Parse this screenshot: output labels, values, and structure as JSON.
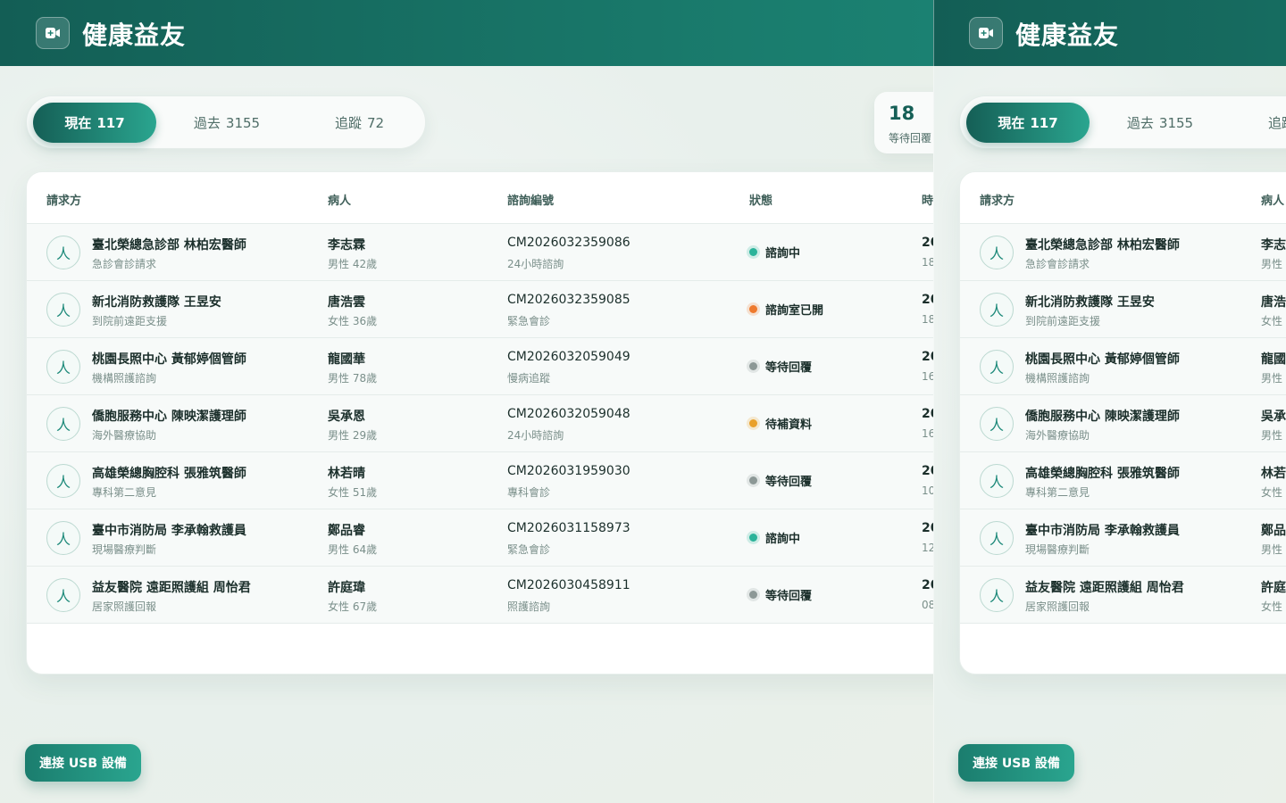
{
  "app": {
    "title": "健康益友",
    "logo_icon": "video-camera-plus-icon"
  },
  "tabs": [
    {
      "label": "現在",
      "count": "117",
      "active": true
    },
    {
      "label": "過去",
      "count": "3155",
      "active": false
    },
    {
      "label": "追蹤",
      "count": "72",
      "active": false
    }
  ],
  "stat": {
    "value": "18",
    "label": "等待回覆"
  },
  "table": {
    "headers": {
      "requester": "請求方",
      "patient": "病人",
      "consult_id": "諮詢編號",
      "status": "狀態",
      "time": "時"
    },
    "rows": [
      {
        "requester": "臺北榮總急診部 林柏宏醫師",
        "request_type": "急診會診請求",
        "patient": "李志霖",
        "patient_info": "男性 42歲",
        "consult_id": "CM2026032359086",
        "consult_type": "24小時諮詢",
        "status": "諮詢中",
        "status_color": "#2bb39a",
        "time_main": "20",
        "time_sub": "18:"
      },
      {
        "requester": "新北消防救護隊 王昱安",
        "request_type": "到院前遠距支援",
        "patient": "唐浩雲",
        "patient_info": "女性 36歲",
        "consult_id": "CM2026032359085",
        "consult_type": "緊急會診",
        "status": "諮詢室已開",
        "status_color": "#ee7a2e",
        "time_main": "20",
        "time_sub": "18:"
      },
      {
        "requester": "桃園長照中心 黃郁婷個管師",
        "request_type": "機構照護諮詢",
        "patient": "龍國華",
        "patient_info": "男性 78歲",
        "consult_id": "CM2026032059049",
        "consult_type": "慢病追蹤",
        "status": "等待回覆",
        "status_color": "#8c9896",
        "time_main": "20",
        "time_sub": "16:"
      },
      {
        "requester": "僑胞服務中心 陳映潔護理師",
        "request_type": "海外醫療協助",
        "patient": "吳承恩",
        "patient_info": "男性 29歲",
        "consult_id": "CM2026032059048",
        "consult_type": "24小時諮詢",
        "status": "待補資料",
        "status_color": "#e9a02a",
        "time_main": "20",
        "time_sub": "16:"
      },
      {
        "requester": "高雄榮總胸腔科 張雅筑醫師",
        "request_type": "專科第二意見",
        "patient": "林若晴",
        "patient_info": "女性 51歲",
        "consult_id": "CM2026031959030",
        "consult_type": "專科會診",
        "status": "等待回覆",
        "status_color": "#8c9896",
        "time_main": "20",
        "time_sub": "10:"
      },
      {
        "requester": "臺中市消防局 李承翰救護員",
        "request_type": "現場醫療判斷",
        "patient": "鄭品睿",
        "patient_info": "男性 64歲",
        "consult_id": "CM2026031158973",
        "consult_type": "緊急會診",
        "status": "諮詢中",
        "status_color": "#2bb39a",
        "time_main": "20",
        "time_sub": "12:"
      },
      {
        "requester": "益友醫院 遠距照護組 周怡君",
        "request_type": "居家照護回報",
        "patient": "許庭瑋",
        "patient_info": "女性 67歲",
        "consult_id": "CM2026030458911",
        "consult_type": "照護諮詢",
        "status": "等待回覆",
        "status_color": "#8c9896",
        "time_main": "20",
        "time_sub": "08"
      }
    ],
    "avatar_icon": "person-icon",
    "avatar_glyph": "人"
  },
  "usb_button": {
    "label": "連接 USB 設備"
  }
}
